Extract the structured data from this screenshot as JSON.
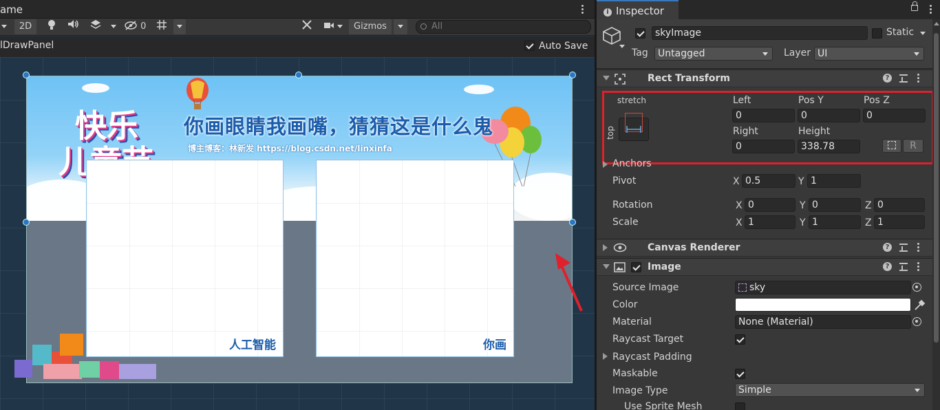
{
  "scene": {
    "tab_label": "ame",
    "toolbar": {
      "mode_2d": "2D",
      "hidden_count": "0",
      "gizmos_label": "Gizmos",
      "search_placeholder": "All"
    },
    "panel_name": "lDrawPanel",
    "auto_save_label": "Auto Save",
    "auto_save_checked": true,
    "canvas": {
      "title": "你画眼睛我画嘴，猜猜这是什么鬼",
      "subtitle": "博主博客：林新发 https://blog.csdn.net/linxinfa",
      "logo_line1": "快乐",
      "logo_line2": "儿童节",
      "frame_left_caption": "人工智能",
      "frame_right_caption": "你画"
    }
  },
  "inspector": {
    "tab_label": "Inspector",
    "object": {
      "name": "skyImage",
      "active": true,
      "static_label": "Static",
      "tag_label": "Tag",
      "tag_value": "Untagged",
      "layer_label": "Layer",
      "layer_value": "UI"
    },
    "rect_transform": {
      "title": "Rect Transform",
      "anchor_h_label": "stretch",
      "anchor_v_label": "top",
      "left_label": "Left",
      "left_value": "0",
      "posy_label": "Pos Y",
      "posy_value": "0",
      "posz_label": "Pos Z",
      "posz_value": "0",
      "right_label": "Right",
      "right_value": "0",
      "height_label": "Height",
      "height_value": "338.78",
      "raw_edit_label": "R",
      "anchors_label": "Anchors",
      "pivot_label": "Pivot",
      "pivot_x": "0.5",
      "pivot_y": "1",
      "rotation_label": "Rotation",
      "rot_x": "0",
      "rot_y": "0",
      "rot_z": "0",
      "scale_label": "Scale",
      "scale_x": "1",
      "scale_y": "1",
      "scale_z": "1",
      "axis_x": "X",
      "axis_y": "Y",
      "axis_z": "Z"
    },
    "canvas_renderer": {
      "title": "Canvas Renderer"
    },
    "image": {
      "title": "Image",
      "enabled": true,
      "source_image_label": "Source Image",
      "source_image_value": "sky",
      "color_label": "Color",
      "color_value": "#ffffff",
      "material_label": "Material",
      "material_value": "None (Material)",
      "raycast_target_label": "Raycast Target",
      "raycast_target_checked": true,
      "raycast_padding_label": "Raycast Padding",
      "maskable_label": "Maskable",
      "maskable_checked": true,
      "image_type_label": "Image Type",
      "image_type_value": "Simple",
      "use_sprite_mesh_label": "Use Sprite Mesh"
    }
  },
  "colors": {
    "selection_highlight": "#e0202a",
    "accent": "#3a79bb"
  }
}
